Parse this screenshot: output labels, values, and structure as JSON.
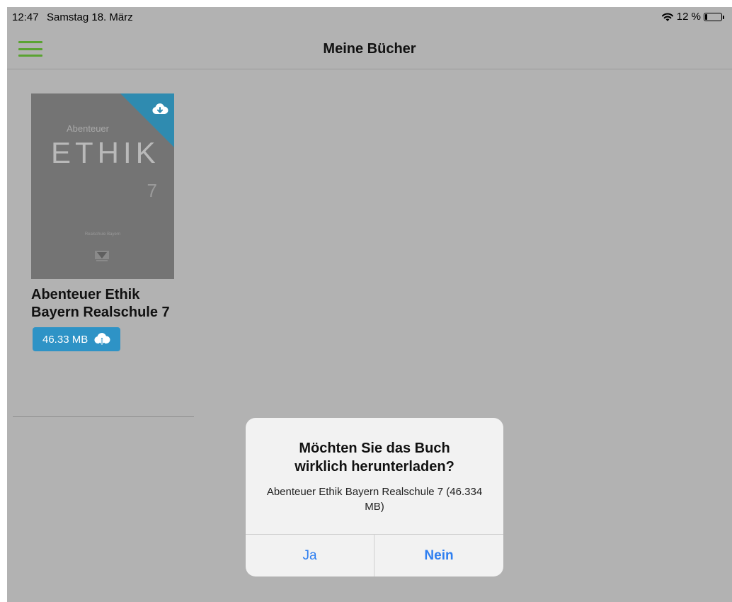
{
  "status_bar": {
    "time": "12:47",
    "date": "Samstag 18. März",
    "battery": "12 %",
    "battery_level_percent": 12
  },
  "nav": {
    "title": "Meine Bücher"
  },
  "book": {
    "cover": {
      "series": "Abenteuer",
      "title": "ETHIK",
      "grade": "7",
      "school": "Realschule Bayern"
    },
    "title": "Abenteuer Ethik Bayern Realschule 7",
    "size_label": "46.33 MB",
    "icon": "cloud-download-icon"
  },
  "dialog": {
    "title": "Möchten Sie das Buch wirklich herunterladen?",
    "message": "Abenteuer Ethik Bayern Realschule 7 (46.334 MB)",
    "yes_label": "Ja",
    "no_label": "Nein"
  },
  "colors": {
    "accent_green": "#5aa331",
    "download_blue": "#2e93c6",
    "link_blue": "#2f7ff0",
    "overlay_gray": "#b2b2b2"
  }
}
